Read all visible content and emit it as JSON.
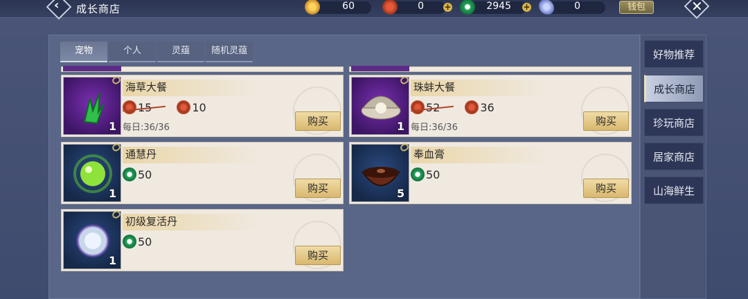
{
  "header": {
    "title": "成长商店",
    "currencies": [
      {
        "name": "gold-coin",
        "value": "60",
        "color": "#d99a2a"
      },
      {
        "name": "red-coin",
        "value": "0",
        "color": "#c0452b"
      },
      {
        "name": "green-jade",
        "value": "2945",
        "color": "#1f9a4e"
      },
      {
        "name": "blue-crystal",
        "value": "0",
        "color": "#7b8ed8"
      }
    ],
    "wallet_label": "钱包"
  },
  "tabs": [
    {
      "label": "宠物",
      "active": true
    },
    {
      "label": "个人",
      "active": false
    },
    {
      "label": "灵蕴",
      "active": false
    },
    {
      "label": "随机灵蕴",
      "active": false
    }
  ],
  "items": [
    {
      "name": "海草大餐",
      "qty": "1",
      "currency": "red-coin",
      "old_price": "15",
      "price": "10",
      "daily": "每日:36/36",
      "buy": "购买"
    },
    {
      "name": "珠蚌大餐",
      "qty": "1",
      "currency": "red-coin",
      "old_price": "52",
      "price": "36",
      "daily": "每日:36/36",
      "buy": "购买"
    },
    {
      "name": "通慧丹",
      "qty": "1",
      "currency": "green-jade",
      "price": "50",
      "buy": "购买"
    },
    {
      "name": "奉血膏",
      "qty": "5",
      "currency": "green-jade",
      "price": "50",
      "buy": "购买"
    },
    {
      "name": "初级复活丹",
      "qty": "1",
      "currency": "green-jade",
      "price": "50",
      "buy": "购买"
    }
  ],
  "sidebar": {
    "items": [
      {
        "label": "好物推荐",
        "active": false
      },
      {
        "label": "成长商店",
        "active": true
      },
      {
        "label": "珍玩商店",
        "active": false
      },
      {
        "label": "居家商店",
        "active": false
      },
      {
        "label": "山海鲜生",
        "active": false
      }
    ]
  }
}
